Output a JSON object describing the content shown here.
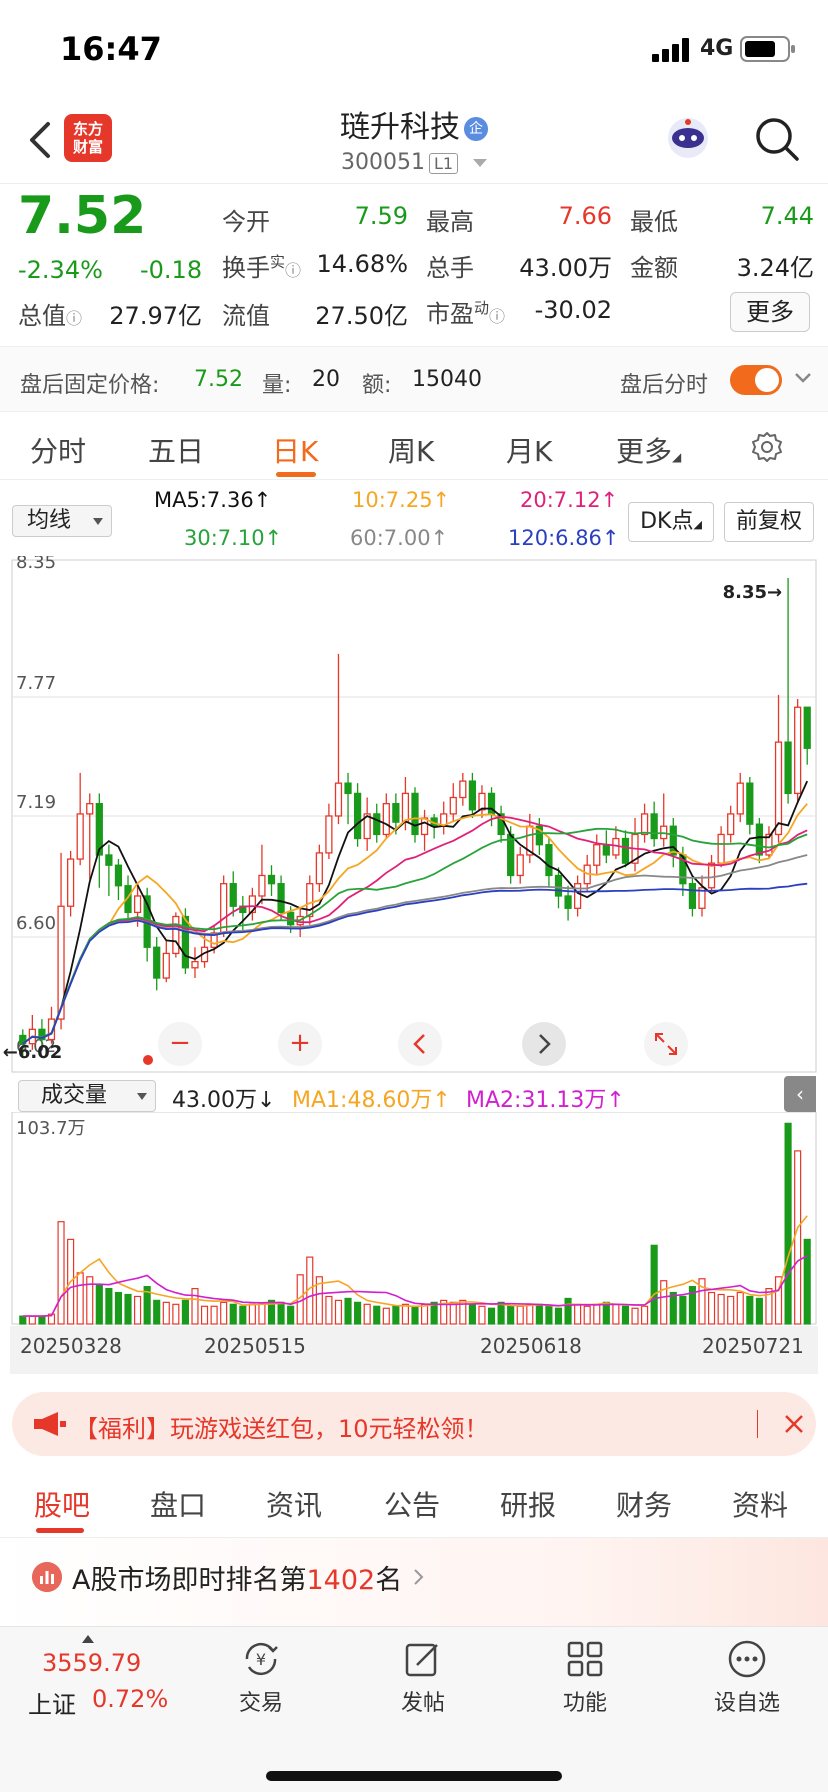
{
  "status_bar": {
    "time": "16:47",
    "network": "4G"
  },
  "header": {
    "logo_line1": "东方",
    "logo_line2": "财富",
    "stock_name": "琏升科技",
    "badge": "企",
    "stock_code": "300051",
    "level": "L1"
  },
  "quote": {
    "price": "7.52",
    "change_pct": "-2.34%",
    "change": "-0.18",
    "open_label": "今开",
    "open": "7.59",
    "high_label": "最高",
    "high": "7.66",
    "low_label": "最低",
    "low": "7.44",
    "turnover_label": "换手",
    "turnover_sup": "实",
    "turnover": "14.68%",
    "volume_label": "总手",
    "volume": "43.00万",
    "amount_label": "金额",
    "amount": "3.24亿",
    "mcap_label": "总值",
    "mcap": "27.97亿",
    "float_label": "流值",
    "float": "27.50亿",
    "pe_label": "市盈",
    "pe_sup": "动",
    "pe": "-30.02",
    "more_label": "更多"
  },
  "after_hours": {
    "label": "盘后固定价格:",
    "price": "7.52",
    "qty_label": "量:",
    "qty": "20",
    "amt_label": "额:",
    "amt": "15040",
    "toggle_label": "盘后分时"
  },
  "periods": [
    "分时",
    "五日",
    "日K",
    "周K",
    "月K",
    "更多"
  ],
  "ma": {
    "select": "均线",
    "ma5": "MA5:7.36↑",
    "ma10": "10:7.25↑",
    "ma20": "20:7.12↑",
    "ma30": "30:7.10↑",
    "ma60": "60:7.00↑",
    "ma120": "120:6.86↑",
    "dk_label": "DK点",
    "fq_label": "前复权"
  },
  "colors": {
    "up": "#e5382b",
    "down": "#1a9a1a",
    "ma5": "#111111",
    "ma10": "#f5a623",
    "ma20": "#e0217a",
    "ma30": "#27a33a",
    "ma60": "#888888",
    "ma120": "#2b3fc0",
    "accent": "#f26a1b"
  },
  "chart_data": [
    {
      "type": "candlestick",
      "y_ticks": [
        "8.35",
        "7.77",
        "7.19",
        "6.60",
        "6.02"
      ],
      "ylim": [
        6.02,
        8.35
      ],
      "max_label": "8.35",
      "min_label": "6.02",
      "x_labels": [
        "20250328",
        "20250515",
        "20250618",
        "20250721"
      ],
      "candles": [
        [
          6.12,
          6.08,
          6.15,
          6.02
        ],
        [
          6.08,
          6.15,
          6.22,
          6.05
        ],
        [
          6.15,
          6.1,
          6.2,
          6.06
        ],
        [
          6.1,
          6.2,
          6.26,
          6.08
        ],
        [
          6.2,
          6.75,
          7.01,
          6.15
        ],
        [
          6.75,
          6.98,
          7.02,
          6.7
        ],
        [
          6.98,
          7.2,
          7.4,
          6.95
        ],
        [
          7.2,
          7.25,
          7.3,
          6.88
        ],
        [
          7.25,
          7.0,
          7.3,
          6.84
        ],
        [
          7.0,
          6.95,
          7.05,
          6.8
        ],
        [
          6.95,
          6.85,
          6.98,
          6.78
        ],
        [
          6.85,
          6.72,
          6.9,
          6.68
        ],
        [
          6.72,
          6.8,
          6.86,
          6.65
        ],
        [
          6.8,
          6.55,
          6.84,
          6.48
        ],
        [
          6.55,
          6.4,
          6.6,
          6.34
        ],
        [
          6.4,
          6.52,
          6.58,
          6.38
        ],
        [
          6.52,
          6.7,
          6.72,
          6.5
        ],
        [
          6.7,
          6.45,
          6.74,
          6.42
        ],
        [
          6.45,
          6.48,
          6.55,
          6.4
        ],
        [
          6.48,
          6.55,
          6.62,
          6.45
        ],
        [
          6.55,
          6.62,
          6.66,
          6.52
        ],
        [
          6.62,
          6.86,
          6.9,
          6.6
        ],
        [
          6.86,
          6.75,
          6.92,
          6.7
        ],
        [
          6.75,
          6.72,
          6.8,
          6.62
        ],
        [
          6.72,
          6.8,
          6.84,
          6.68
        ],
        [
          6.8,
          6.9,
          7.05,
          6.76
        ],
        [
          6.9,
          6.86,
          6.95,
          6.8
        ],
        [
          6.86,
          6.72,
          6.9,
          6.68
        ],
        [
          6.72,
          6.66,
          6.75,
          6.62
        ],
        [
          6.66,
          6.7,
          6.74,
          6.6
        ],
        [
          6.7,
          6.86,
          6.9,
          6.66
        ],
        [
          6.86,
          7.01,
          7.05,
          6.82
        ],
        [
          7.01,
          7.19,
          7.25,
          6.98
        ],
        [
          7.19,
          7.35,
          7.98,
          7.15
        ],
        [
          7.35,
          7.3,
          7.4,
          7.15
        ],
        [
          7.3,
          7.08,
          7.35,
          7.04
        ],
        [
          7.08,
          7.2,
          7.28,
          7.02
        ],
        [
          7.2,
          7.1,
          7.25,
          7.06
        ],
        [
          7.1,
          7.25,
          7.3,
          7.08
        ],
        [
          7.25,
          7.16,
          7.3,
          7.1
        ],
        [
          7.16,
          7.3,
          7.38,
          7.12
        ],
        [
          7.3,
          7.1,
          7.33,
          7.06
        ],
        [
          7.1,
          7.18,
          7.22,
          7.02
        ],
        [
          7.18,
          7.14,
          7.2,
          7.08
        ],
        [
          7.14,
          7.2,
          7.26,
          7.1
        ],
        [
          7.2,
          7.28,
          7.35,
          7.16
        ],
        [
          7.28,
          7.36,
          7.4,
          7.24
        ],
        [
          7.36,
          7.22,
          7.4,
          7.18
        ],
        [
          7.22,
          7.3,
          7.34,
          7.18
        ],
        [
          7.3,
          7.2,
          7.33,
          7.14
        ],
        [
          7.2,
          7.1,
          7.24,
          7.06
        ],
        [
          7.1,
          6.9,
          7.14,
          6.86
        ],
        [
          6.9,
          7.0,
          7.04,
          6.86
        ],
        [
          7.0,
          7.14,
          7.2,
          6.96
        ],
        [
          7.14,
          7.05,
          7.18,
          7.0
        ],
        [
          7.05,
          6.9,
          7.08,
          6.84
        ],
        [
          6.9,
          6.8,
          6.94,
          6.74
        ],
        [
          6.8,
          6.74,
          6.85,
          6.68
        ],
        [
          6.74,
          6.86,
          6.9,
          6.7
        ],
        [
          6.86,
          6.95,
          7.0,
          6.82
        ],
        [
          6.95,
          7.05,
          7.1,
          6.9
        ],
        [
          7.05,
          7.0,
          7.12,
          6.96
        ],
        [
          7.0,
          7.08,
          7.14,
          6.98
        ],
        [
          7.08,
          6.96,
          7.12,
          6.94
        ],
        [
          6.96,
          7.1,
          7.18,
          6.92
        ],
        [
          7.1,
          7.2,
          7.25,
          7.06
        ],
        [
          7.2,
          7.08,
          7.26,
          7.04
        ],
        [
          7.08,
          7.14,
          7.3,
          7.04
        ],
        [
          7.14,
          7.0,
          7.18,
          6.94
        ],
        [
          7.0,
          6.86,
          7.04,
          6.8
        ],
        [
          6.86,
          6.74,
          6.9,
          6.7
        ],
        [
          6.74,
          6.84,
          6.9,
          6.7
        ],
        [
          6.84,
          6.96,
          7.0,
          6.82
        ],
        [
          6.96,
          7.1,
          7.14,
          6.94
        ],
        [
          7.1,
          7.2,
          7.24,
          7.06
        ],
        [
          7.2,
          7.35,
          7.4,
          7.16
        ],
        [
          7.35,
          7.15,
          7.38,
          7.1
        ],
        [
          7.15,
          7.0,
          7.18,
          6.96
        ],
        [
          7.0,
          7.1,
          7.14,
          6.98
        ],
        [
          7.1,
          7.55,
          7.78,
          7.06
        ],
        [
          7.55,
          7.3,
          8.35,
          7.25
        ],
        [
          7.3,
          7.72,
          7.76,
          7.25
        ],
        [
          7.72,
          7.52,
          7.66,
          7.44
        ]
      ],
      "ma_last": {
        "ma5": 7.36,
        "ma10": 7.25,
        "ma20": 7.12,
        "ma30": 7.1,
        "ma60": 7.0,
        "ma120": 6.86
      }
    },
    {
      "type": "bar",
      "title": "成交量",
      "current": "43.00万↓",
      "ma1": "MA1:48.60万↑",
      "ma2": "MA2:31.13万↑",
      "ylim_label": "103.7万",
      "ylim": [
        0,
        103.7
      ],
      "values": [
        4,
        4,
        4,
        5,
        52,
        43,
        26,
        24,
        20,
        18,
        16,
        15,
        14,
        19,
        12,
        11,
        10,
        12,
        18,
        9,
        9,
        11,
        10,
        9,
        10,
        10,
        12,
        11,
        9,
        25,
        34,
        24,
        14,
        12,
        13,
        11,
        10,
        9,
        8,
        9,
        10,
        9,
        10,
        11,
        12,
        11,
        12,
        10,
        9,
        8,
        11,
        9,
        9,
        10,
        10,
        9,
        8,
        13,
        10,
        9,
        10,
        11,
        10,
        9,
        8,
        9,
        40,
        22,
        16,
        14,
        19,
        23,
        16,
        15,
        14,
        16,
        14,
        13,
        18,
        24,
        102,
        88,
        43
      ]
    }
  ],
  "chart_controls": {
    "minus": "−",
    "plus": "+"
  },
  "banner": {
    "text": "【福利】玩游戏送红包，10元轻松领！"
  },
  "bottom_tabs": [
    "股吧",
    "盘口",
    "资讯",
    "公告",
    "研报",
    "财务",
    "资料"
  ],
  "rank": {
    "prefix": "A股市场即时排名第",
    "num": "1402",
    "suffix": "名"
  },
  "bottom_nav": {
    "index_value": "3559.79",
    "index_name": "上证",
    "index_pct": "0.72%",
    "items": [
      "交易",
      "发帖",
      "功能",
      "设自选"
    ]
  }
}
